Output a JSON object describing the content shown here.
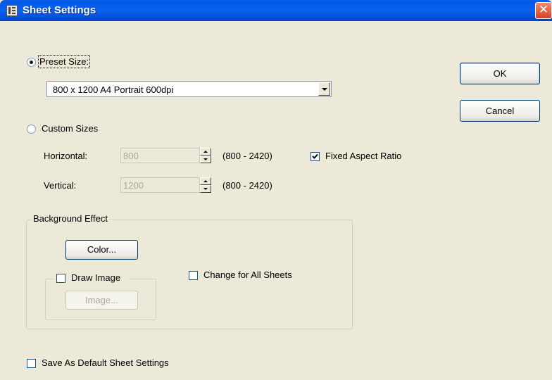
{
  "window": {
    "title": "Sheet Settings",
    "close_symbol": "✕"
  },
  "preset": {
    "label": "Preset Size:",
    "selected": true,
    "combo_value": "800 x 1200 A4 Portrait 600dpi"
  },
  "custom": {
    "label": "Custom Sizes",
    "selected": false,
    "horizontal": {
      "label": "Horizontal:",
      "value": "800",
      "range": "(800 - 2420)"
    },
    "vertical": {
      "label": "Vertical:",
      "value": "1200",
      "range": "(800 - 2420)"
    },
    "fixed_aspect": {
      "label": "Fixed Aspect Ratio",
      "checked": true
    }
  },
  "background_effect": {
    "legend": "Background Effect",
    "color_button": "Color...",
    "draw_image": {
      "label": "Draw Image",
      "checked": false
    },
    "image_button": "Image...",
    "change_all": {
      "label": "Change for All Sheets",
      "checked": false
    }
  },
  "save_default": {
    "label": "Save As Default Sheet Settings",
    "checked": false
  },
  "buttons": {
    "ok": "OK",
    "cancel": "Cancel"
  }
}
